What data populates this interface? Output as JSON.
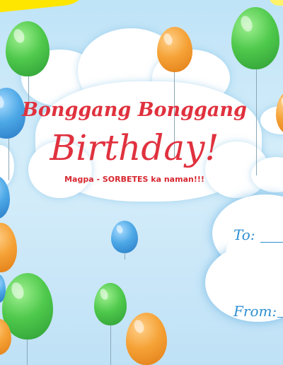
{
  "card": {
    "title_line1": "Bonggang Bonggang",
    "title_line2": "Birthday!",
    "subtitle": "Magpa - SORBETES ka naman!!!",
    "to_label": "To:",
    "from_label": "From:"
  },
  "colors": {
    "sky": "#bfe3f7",
    "title_red": "#e0313e",
    "field_blue": "#2e8fd1",
    "yellow_accent": "#ffe600"
  }
}
